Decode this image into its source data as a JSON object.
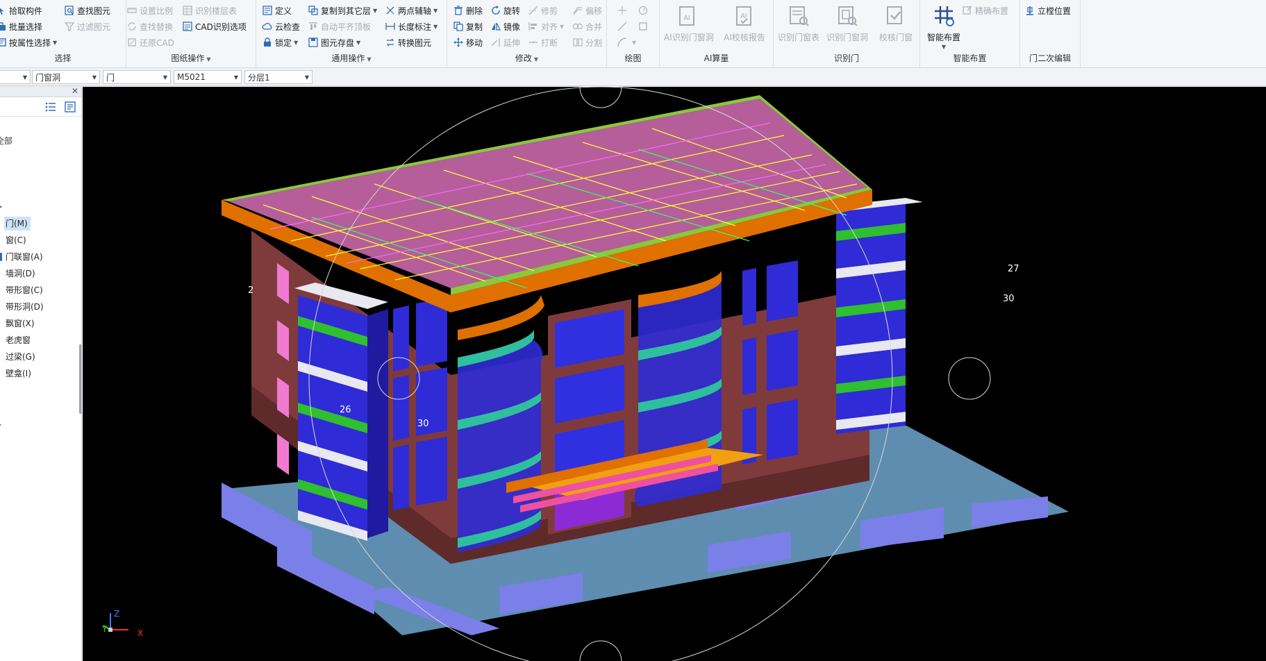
{
  "ribbon": {
    "select": {
      "label": "选择",
      "pick": "拾取构件",
      "batch": "批量选择",
      "by_attr": "按属性选择",
      "find": "查找图元",
      "filter": "过滤图元"
    },
    "drawing_ops": {
      "label": "图纸操作",
      "set_scale": "设置比例",
      "find_replace": "查找替换",
      "restore_cad": "还原CAD",
      "identify_floor": "识别楼层表",
      "cad_options": "CAD识别选项"
    },
    "common_ops": {
      "label": "通用操作",
      "define": "定义",
      "cloud_check": "云检查",
      "lock": "锁定",
      "copy_to_other": "复制到其它层",
      "auto_align": "自动平齐顶板",
      "save_element": "图元存盘",
      "two_point_axis": "两点辅轴",
      "length_dim": "长度标注",
      "convert_element": "转换图元"
    },
    "modify": {
      "label": "修改",
      "delete": "删除",
      "copy": "复制",
      "move": "移动",
      "rotate": "旋转",
      "mirror": "镜像",
      "extend": "延伸",
      "trim": "修剪",
      "align": "对齐",
      "break": "打断",
      "offset": "偏移",
      "merge": "合并",
      "split": "分割"
    },
    "draw": {
      "label": "绘图"
    },
    "ai": {
      "label": "AI算量",
      "ai_identify": "AI识别门窗洞",
      "ai_check": "AI校核报告"
    },
    "identify_door": {
      "label": "识别门",
      "table": "识别门窗表",
      "hole": "识别门窗洞",
      "check": "校核门窗"
    },
    "smart": {
      "label": "智能布置",
      "smart_place": "智能布置",
      "precise_place": "精确布置"
    },
    "secondary_edit": {
      "label": "门二次编辑",
      "frame_pos": "立樘位置"
    }
  },
  "selectors": {
    "floor": "",
    "category": "门窗洞",
    "type": "门",
    "name": "M5021",
    "layer": "分层1"
  },
  "left_panel": {
    "fragment_top": "全部",
    "tree": [
      "门(M)",
      "窗(C)",
      "门联窗(A)",
      "墙洞(D)",
      "带形窗(C)",
      "带形洞(D)",
      "飘窗(X)",
      "老虎窗",
      "过梁(G)",
      "壁龛(I)"
    ],
    "selected_index": 0
  },
  "viewport": {
    "axis_x": "X",
    "axis_y": "Y",
    "axis_z": "Z",
    "marks": [
      "26",
      "30",
      "27",
      "30",
      "2"
    ]
  },
  "colors": {
    "accent": "#2a6ebd",
    "selection": "#cde3f7",
    "viewport_bg": "#000000",
    "roof_slab": "#b55e9a",
    "parapet": "#8dc63f",
    "wall": "#7f3b3b",
    "curtain_wall": "#2f2bd6",
    "balcony_band": "#2fbf9e",
    "foundation": "#7b7fe8"
  }
}
